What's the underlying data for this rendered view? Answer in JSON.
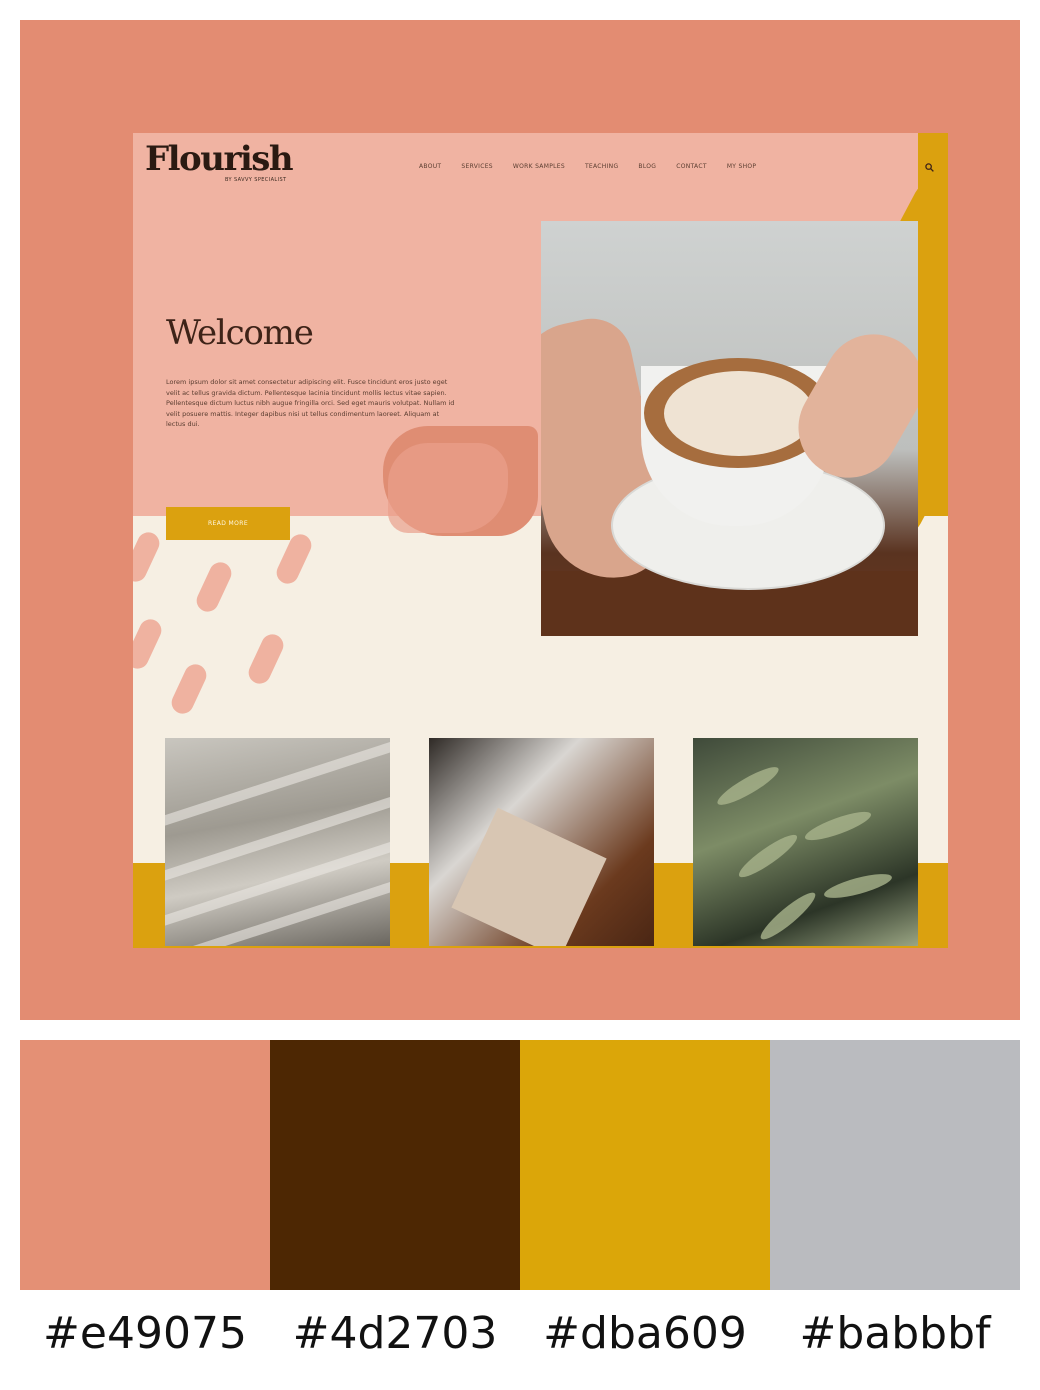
{
  "site": {
    "logo": "Flourish",
    "logo_subtitle": "BY SAVVY SPECIALIST",
    "nav": [
      "ABOUT",
      "SERVICES",
      "WORK SAMPLES",
      "TEACHING",
      "BLOG",
      "CONTACT",
      "MY SHOP"
    ],
    "heading": "Welcome",
    "body_text": "Lorem ipsum dolor sit amet consectetur adipiscing elit. Fusce tincidunt eros justo eget velit ac tellus gravida dictum. Pellentesque lacinia tincidunt mollis lectus vitae sapien. Pellentesque dictum luctus nibh augue fringilla orci. Sed eget mauris volutpat. Nullam id velit posuere mattis. Integer dapibus nisi ut tellus condimentum laoreet. Aliquam at lectus dui.",
    "cta_label": "READ MORE"
  },
  "palette": {
    "colors": [
      "#e49075",
      "#4d2703",
      "#dba609",
      "#babbbf"
    ],
    "labels": [
      "#e49075",
      "#4d2703",
      "#dba609",
      "#babbbf"
    ]
  }
}
